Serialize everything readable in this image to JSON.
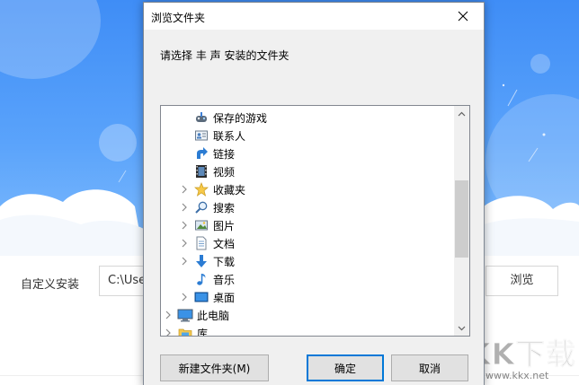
{
  "installer": {
    "custom_install_label": "自定义安装",
    "install_path": "C:\\Use",
    "browse_label": "浏览",
    "sky_color": "#4a96f8"
  },
  "watermark": {
    "text": "KK下载",
    "url": "www.kkx.net"
  },
  "dialog": {
    "title": "浏览文件夹",
    "instruction": "请选择 丰 声 安装的文件夹",
    "tree_items": [
      {
        "label": "保存的游戏",
        "icon": "saved-games-icon",
        "expandable": false
      },
      {
        "label": "联系人",
        "icon": "contacts-icon",
        "expandable": false
      },
      {
        "label": "链接",
        "icon": "links-icon",
        "expandable": false
      },
      {
        "label": "视频",
        "icon": "videos-icon",
        "expandable": false
      },
      {
        "label": "收藏夹",
        "icon": "favorites-icon",
        "expandable": true
      },
      {
        "label": "搜索",
        "icon": "search-icon",
        "expandable": true
      },
      {
        "label": "图片",
        "icon": "pictures-icon",
        "expandable": true
      },
      {
        "label": "文档",
        "icon": "documents-icon",
        "expandable": true
      },
      {
        "label": "下载",
        "icon": "downloads-icon",
        "expandable": true
      },
      {
        "label": "音乐",
        "icon": "music-icon",
        "expandable": false
      },
      {
        "label": "桌面",
        "icon": "desktop-icon",
        "expandable": true
      },
      {
        "label": "此电脑",
        "icon": "this-pc-icon",
        "expandable": true
      },
      {
        "label": "库",
        "icon": "libraries-icon",
        "expandable": true
      }
    ],
    "buttons": {
      "new_folder": "新建文件夹(M)",
      "ok": "确定",
      "cancel": "取消"
    },
    "accent_color": "#0078d7"
  }
}
